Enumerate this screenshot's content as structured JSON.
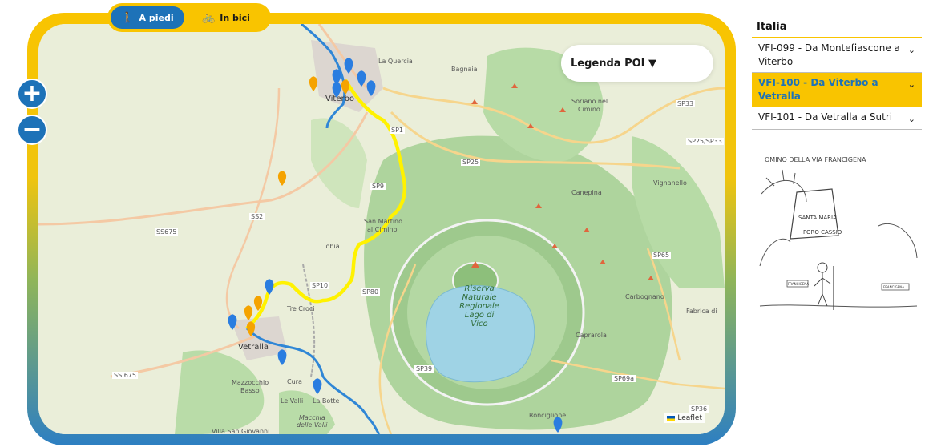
{
  "mode_toggle": {
    "walk_label": "A piedi",
    "bike_label": "In bici",
    "walk_icon": "hiker-icon",
    "bike_icon": "bicycle-icon"
  },
  "zoom": {
    "in_label": "+",
    "out_label": "−"
  },
  "legend": {
    "label": "Legenda POI ▼"
  },
  "attribution": {
    "label": "Leaflet"
  },
  "map_labels": {
    "viterbo": "Viterbo",
    "la_quercia": "La Quercia",
    "bagnaia": "Bagnaia",
    "soriano": "Soriano nel",
    "cimino": "Cimino",
    "sp1": "SP1",
    "sp25": "SP25",
    "sp9": "SP9",
    "sp33": "SP33",
    "sp25_33": "SP25/SP33",
    "sp2": "SS2",
    "ss675": "SS675",
    "ss675b": "SS 675",
    "sp10": "SP10",
    "sp80": "SP80",
    "sp39": "SP39",
    "sp65": "SP65",
    "sp69a": "SP69a",
    "sp36": "SP36",
    "canepina": "Canepina",
    "vignanello": "Vignanello",
    "san_martino": "San Martino",
    "al_cimino": "al Cimino",
    "tobia": "Tobia",
    "tre_croci": "Tre Croci",
    "vetralla": "Vetralla",
    "mazzocchio": "Mazzocchio",
    "basso": "Basso",
    "cura": "Cura",
    "la_botte": "La Botte",
    "le_valli": "Le Valli",
    "macchia": "Macchia",
    "delle_valli": "delle Valli",
    "villa_san_giovanni": "Villa San Giovanni",
    "riserva1": "Riserva",
    "riserva2": "Naturale",
    "riserva3": "Regionale",
    "riserva4": "Lago di",
    "riserva5": "Vico",
    "carbognano": "Carbognano",
    "caprarola": "Caprarola",
    "fabrica": "Fabrica di",
    "ronciglione": "Ronciglione"
  },
  "sidebar": {
    "country": "Italia",
    "routes": [
      {
        "label": "VFI-099 - Da Montefiascone a Viterbo",
        "active": false
      },
      {
        "label": "VFI-100 - Da Viterbo a Vetralla",
        "active": true
      },
      {
        "label": "VFI-101 - Da Vetralla a Sutri",
        "active": false
      }
    ]
  },
  "drawing": {
    "caption": "OMINO DELLA VIA FRANCIGENA",
    "sign": "SANTA MARIA",
    "sign2": "FORO CASSIO",
    "small_sign_left": "FRANCIGENA",
    "small_sign_right": "FRANCIGENA"
  },
  "colors": {
    "accent_yellow": "#f9c400",
    "accent_blue": "#1d72b8",
    "route_yellow": "#fff200",
    "route_blue": "#2f86d6",
    "poi_orange": "#f5a300",
    "poi_blue": "#2a7de0",
    "lake": "#9fd3e5",
    "forest": "#a6d097"
  }
}
